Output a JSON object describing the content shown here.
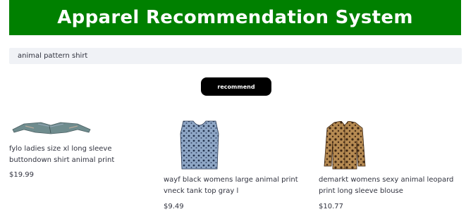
{
  "header": {
    "title": "Apparel Recommendation System"
  },
  "search": {
    "value": "animal pattern shirt"
  },
  "actions": {
    "recommend_label": "recommend"
  },
  "products": [
    {
      "title": "fylo ladies size xl long sleeve buttondown shirt animal print",
      "price": "$19.99",
      "image": "denim-shirt"
    },
    {
      "title": "wayf black womens large animal print vneck tank top gray l",
      "price": "$9.49",
      "image": "blue-leopard-tank"
    },
    {
      "title": "demarkt womens sexy animal leopard print long sleeve blouse",
      "price": "$10.77",
      "image": "leopard-blouse"
    }
  ],
  "colors": {
    "header_bg": "#008000",
    "button_bg": "#000000",
    "input_bg": "#f0f2f6"
  }
}
